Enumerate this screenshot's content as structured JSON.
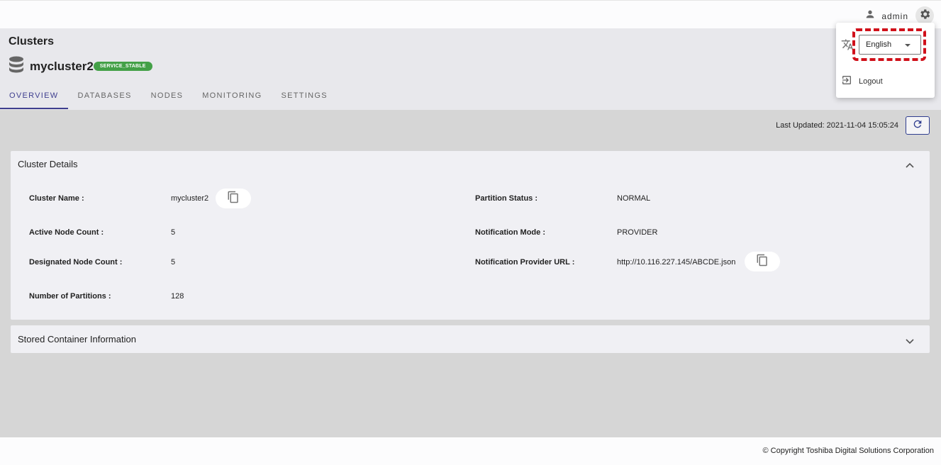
{
  "topbar": {
    "user_name": "admin",
    "user_icon": "person-icon",
    "settings_icon": "gear-icon"
  },
  "header": {
    "title": "Clusters",
    "cluster_name": "mycluster2",
    "status": "SERVICE_STABLE",
    "status_color": "#43a047",
    "tabs": [
      "OVERVIEW",
      "DATABASES",
      "NODES",
      "MONITORING",
      "SETTINGS"
    ],
    "active_tab": "OVERVIEW"
  },
  "toolbar": {
    "last_updated": "Last Updated: 2021-11-04 15:05:24",
    "refresh_icon": "refresh-icon"
  },
  "cluster_details": {
    "title": "Cluster Details",
    "left": [
      {
        "label": "Cluster Name :",
        "value": "mycluster2"
      },
      {
        "label": "Active Node Count :",
        "value": "5"
      },
      {
        "label": "Designated Node Count :",
        "value": "5"
      },
      {
        "label": "Number of Partitions :",
        "value": "128"
      }
    ],
    "right": [
      {
        "label": "Partition Status :",
        "value": "NORMAL"
      },
      {
        "label": "Notification Mode :",
        "value": "PROVIDER"
      },
      {
        "label": "Notification Provider URL :",
        "value": "http://10.116.227.145/ABCDE.json"
      }
    ]
  },
  "stored_container": {
    "title": "Stored Container Information"
  },
  "footer": {
    "copyright": "© Copyright Toshiba Digital Solutions Corporation"
  },
  "menu": {
    "language": "English",
    "logout": "Logout",
    "highlight_color": "#d0101a"
  },
  "colors": {
    "accent": "#3f3f8f",
    "background": "#d6d6d6"
  }
}
